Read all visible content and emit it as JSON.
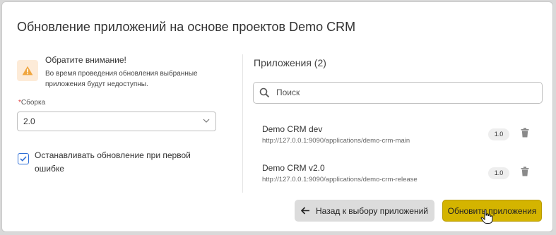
{
  "dialog": {
    "title": "Обновление приложений на основе проектов Demo CRM"
  },
  "warning": {
    "icon": "warning-triangle-icon",
    "title": "Обратите внимание!",
    "text": "Во время проведения обновления выбранные приложения будут недоступны."
  },
  "build": {
    "label": "Сборка",
    "value": "2.0"
  },
  "stop_on_error": {
    "checked": true,
    "label": "Останавливать обновление при первой ошибке"
  },
  "apps": {
    "title": "Приложения (2)",
    "search_placeholder": "Поиск",
    "items": [
      {
        "name": "Demo CRM dev",
        "url": "http://127.0.0.1:9090/applications/demo-crm-main",
        "version": "1.0"
      },
      {
        "name": "Demo CRM v2.0",
        "url": "http://127.0.0.1:9090/applications/demo-crm-release",
        "version": "1.0"
      }
    ]
  },
  "buttons": {
    "back": "Назад к выбору приложений",
    "update": "Обновить приложения"
  },
  "colors": {
    "accent": "#d4b400",
    "warning": "#f0a640",
    "checkbox": "#2f6fd6"
  }
}
